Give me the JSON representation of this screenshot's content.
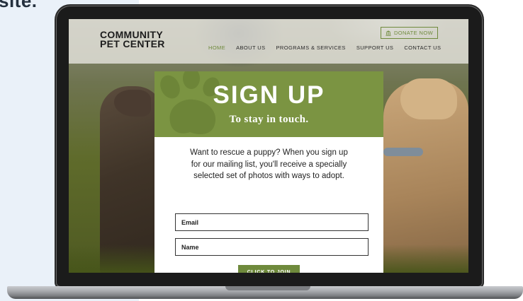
{
  "corner_text": "site.",
  "site": {
    "logo_line1": "COMMUNITY",
    "logo_line2": "PET CENTER",
    "nav": [
      {
        "label": "HOME",
        "active": true
      },
      {
        "label": "ABOUT US",
        "active": false
      },
      {
        "label": "PROGRAMS & SERVICES",
        "active": false
      },
      {
        "label": "SUPPORT US",
        "active": false
      },
      {
        "label": "CONTACT US",
        "active": false
      }
    ],
    "donate_label": "DONATE NOW",
    "donate_icon": "bank-icon"
  },
  "modal": {
    "title": "SIGN UP",
    "subtitle": "To stay in touch.",
    "body_lines": [
      "Want to rescue a puppy? When you sign up",
      "for our mailing list, you'll receive a specially",
      "selected set of photos with ways to adopt."
    ],
    "email_placeholder": "Email",
    "name_placeholder": "Name",
    "button_label": "CLICK TO JOIN",
    "decoration_icon": "paw-print-icon"
  },
  "colors": {
    "accent": "#7b9442",
    "accent_dark": "#6f8a3c",
    "header_bg": "#e0ded6"
  }
}
